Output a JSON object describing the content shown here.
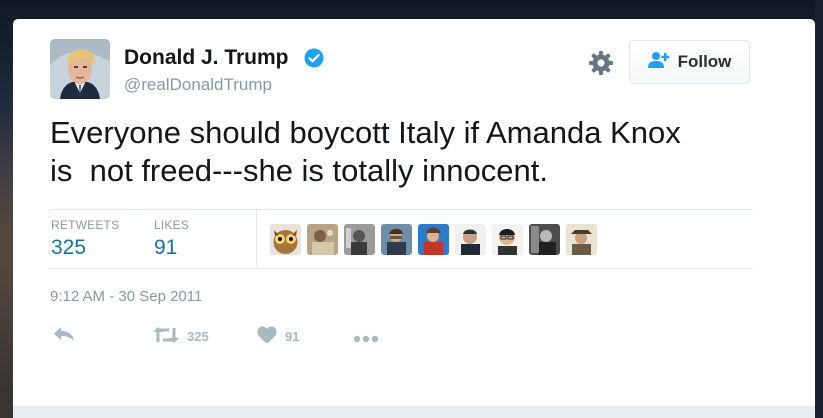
{
  "tweet": {
    "author_name": "Donald J. Trump",
    "handle": "@realDonaldTrump",
    "text": "Everyone should boycott Italy if Amanda Knox\nis  not freed---she is totally innocent.",
    "timestamp": "9:12 AM - 30 Sep 2011"
  },
  "header": {
    "follow_label": "Follow",
    "settings_icon": "gear-icon",
    "follow_icon": "add-user-icon",
    "verified_icon": "verified-badge-icon"
  },
  "stats": {
    "retweets_label": "RETWEETS",
    "retweets_value": "325",
    "likes_label": "LIKES",
    "likes_value": "91"
  },
  "likers": {
    "count_shown": 9
  },
  "actions": {
    "reply_icon": "reply-icon",
    "retweet_icon": "retweet-icon",
    "retweet_count": "325",
    "like_icon": "heart-icon",
    "like_count": "91",
    "more_icon": "more-icon"
  },
  "colors": {
    "link_blue": "#1b6fa1",
    "verified_blue": "#1da1f2",
    "muted": "#8899a6",
    "icon_gray": "#aab8c2"
  }
}
